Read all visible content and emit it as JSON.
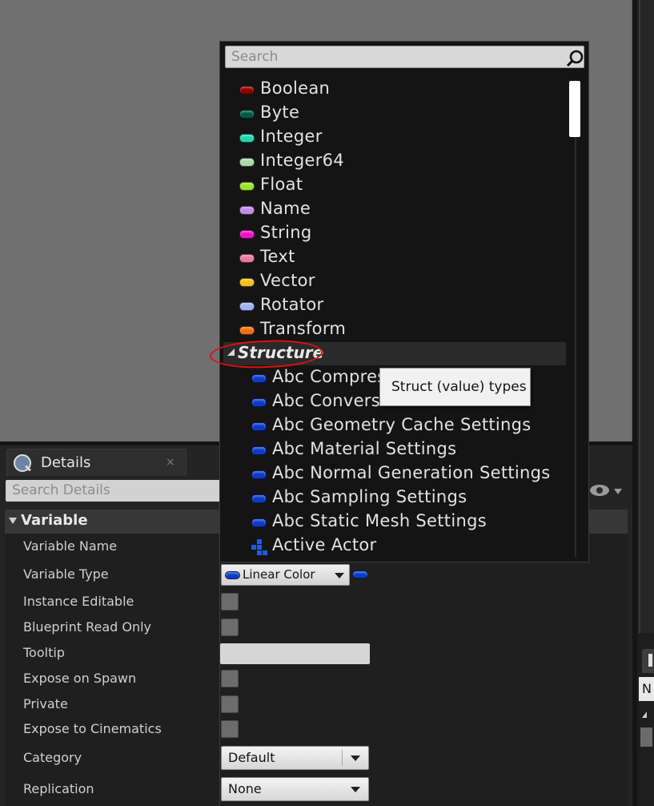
{
  "details_panel": {
    "tab_label": "Details",
    "tab_close": "×",
    "search_placeholder": "Search Details",
    "category": "Variable",
    "properties": {
      "variable_name": "Variable Name",
      "variable_type": "Variable Type",
      "instance_editable": "Instance Editable",
      "blueprint_read_only": "Blueprint Read Only",
      "tooltip": "Tooltip",
      "expose_on_spawn": "Expose on Spawn",
      "private": "Private",
      "expose_to_cinematics": "Expose to Cinematics",
      "category": "Category",
      "replication": "Replication"
    },
    "variable_type_value": "Linear Color",
    "category_value": "Default",
    "replication_value": "None"
  },
  "type_picker": {
    "search_placeholder": "Search",
    "types": [
      {
        "label": "Boolean",
        "color": "#8b0000"
      },
      {
        "label": "Byte",
        "color": "#005a4a"
      },
      {
        "label": "Integer",
        "color": "#1ed6a8"
      },
      {
        "label": "Integer64",
        "color": "#a9d8a9"
      },
      {
        "label": "Float",
        "color": "#9be22a"
      },
      {
        "label": "Name",
        "color": "#c48ae8"
      },
      {
        "label": "String",
        "color": "#f012c8"
      },
      {
        "label": "Text",
        "color": "#e87aa2"
      },
      {
        "label": "Vector",
        "color": "#f5c21b"
      },
      {
        "label": "Rotator",
        "color": "#a0b0f0"
      },
      {
        "label": "Transform",
        "color": "#f07010"
      }
    ],
    "structure_header": "Structure",
    "structures": [
      {
        "label": "Abc Compres"
      },
      {
        "label": "Abc Convers"
      },
      {
        "label": "Abc Geometry Cache Settings"
      },
      {
        "label": "Abc Material Settings"
      },
      {
        "label": "Abc Normal Generation Settings"
      },
      {
        "label": "Abc Sampling Settings"
      },
      {
        "label": "Abc Static Mesh Settings"
      },
      {
        "label": "Active Actor"
      }
    ],
    "struct_color": "#0a3cc8",
    "tooltip": "Struct (value) types"
  },
  "right_panel": {
    "input_value": "N"
  }
}
